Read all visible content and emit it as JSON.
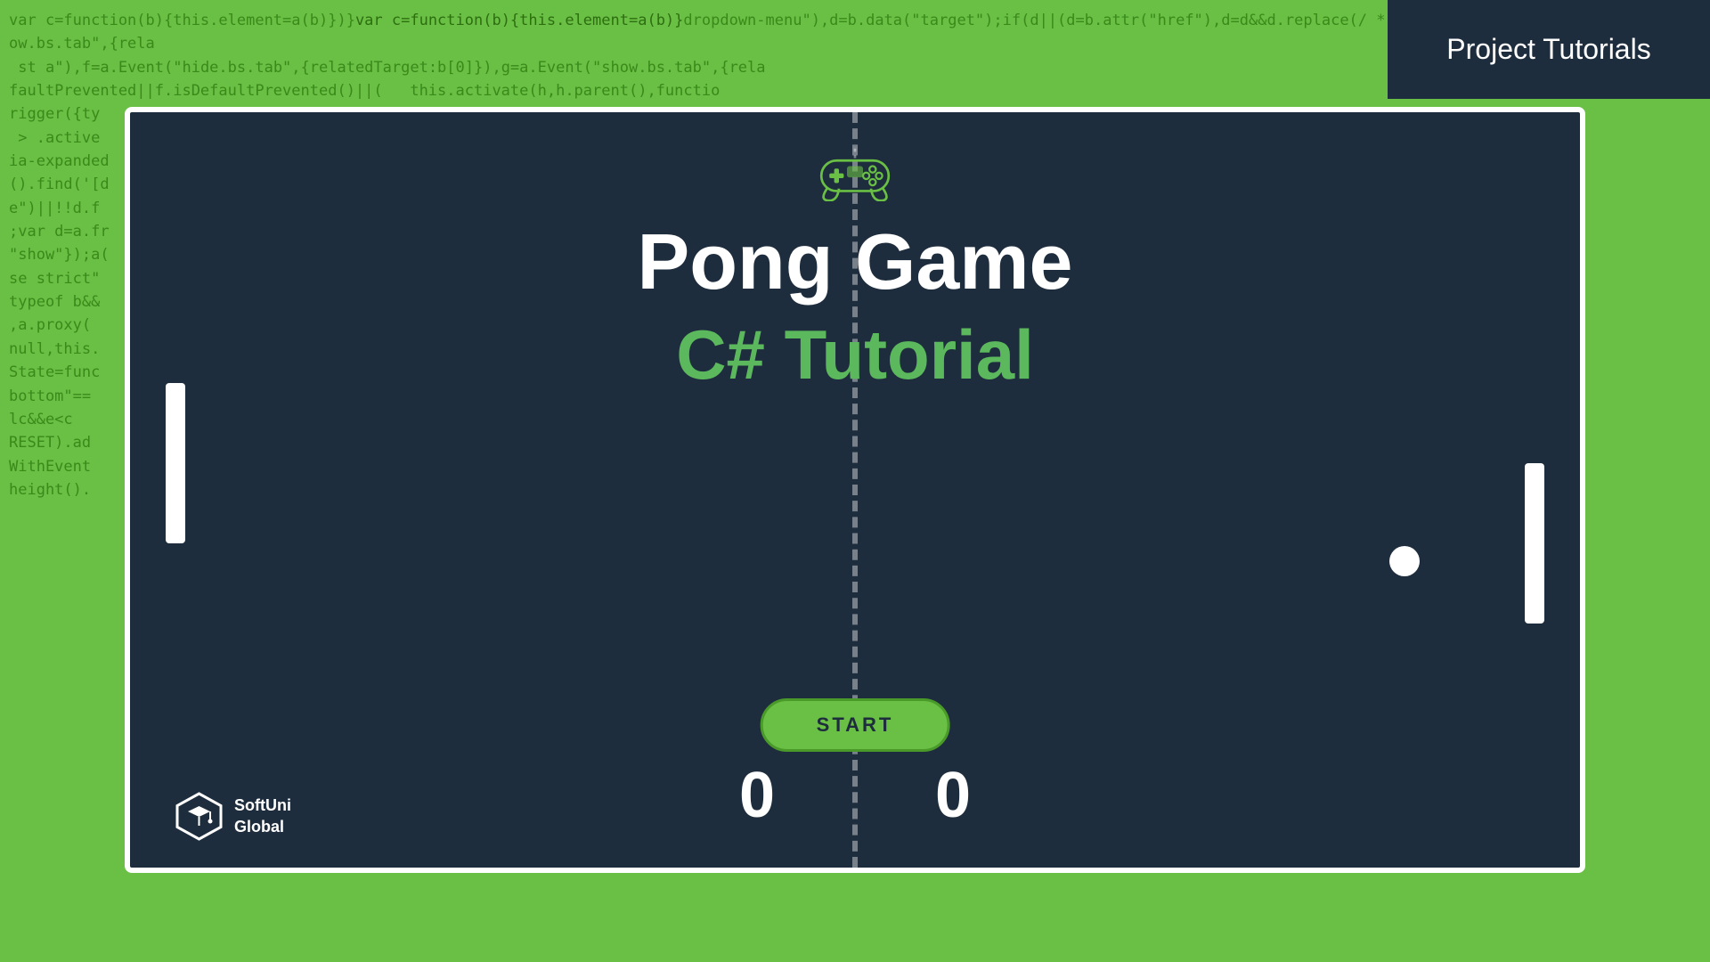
{
  "header": {
    "banner_text": "Project Tutorials",
    "banner_bg": "#1e2d3d"
  },
  "game": {
    "title": "Pong Game",
    "subtitle": "C# Tutorial",
    "start_button_label": "START",
    "score_left": "0",
    "score_right": "0"
  },
  "branding": {
    "name_line1": "SoftUni",
    "name_line2": "Global"
  },
  "code_bg_text": "var c=function(b){this.element=a(b)});var c=function(b){this.element=a(b)}dropdownmenu\"),d=b.data(\"target\");if(d||(d=b.attr(\"href\"),d=d&&d.replace(/ *(?=#[^\\s]*)/, \"\"))),g=a.Event(\"show.bs.tab\",{rela st a\"),f=a.Event(\"hide.bs.tab\",{relatedTarget:b[0]}),g=a.Event(\"show.bs.tab\",{rela faultPrevented||f.isDefaultPrevented()||( this.activate(h,h.parent(),functio rigger({ty > .active ia-expanded .activate a().find('[d e\")||!!d.f ;var d=a.fr \"show\"});a( se strict\" typeof b&& ,a.proxy( null,this. State=func bottom\"== lcg&&e<c RESET).ad WithEvent height(). $target.scrollTop(),h=function(){setTimeout("
}
